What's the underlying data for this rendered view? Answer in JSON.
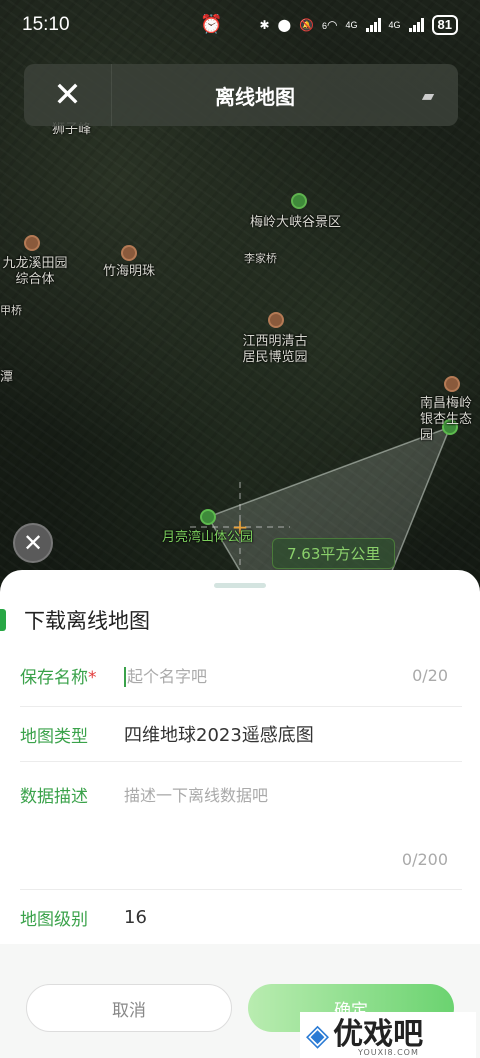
{
  "status_bar": {
    "time": "15:10",
    "battery": "81",
    "network_1": "4G",
    "network_2": "4G",
    "wifi_badge": "6"
  },
  "header": {
    "title": "离线地图"
  },
  "map": {
    "labels": [
      "狮子峰",
      "梅岭大峡谷景区",
      "九龙溪田园综合体",
      "竹海明珠",
      "李家桥",
      "江西明清古居民博览园",
      "南昌梅岭银杏生态园",
      "月亮湾山体公园",
      "甲桥",
      "潭"
    ],
    "area_badge": "7.63平方公里"
  },
  "sheet": {
    "title": "下载离线地图",
    "fields": {
      "save_name": {
        "label": "保存名称",
        "required_mark": "*",
        "placeholder": "起个名字吧",
        "counter": "0/20"
      },
      "map_type": {
        "label": "地图类型",
        "value": "四维地球2023遥感底图"
      },
      "description": {
        "label": "数据描述",
        "placeholder": "描述一下离线数据吧",
        "counter": "0/200"
      },
      "map_level": {
        "label": "地图级别",
        "value": "16"
      }
    },
    "buttons": {
      "cancel": "取消",
      "confirm": "确定"
    }
  },
  "watermark": {
    "brand": "优戏吧",
    "sub": "YOUXI8.COM"
  }
}
